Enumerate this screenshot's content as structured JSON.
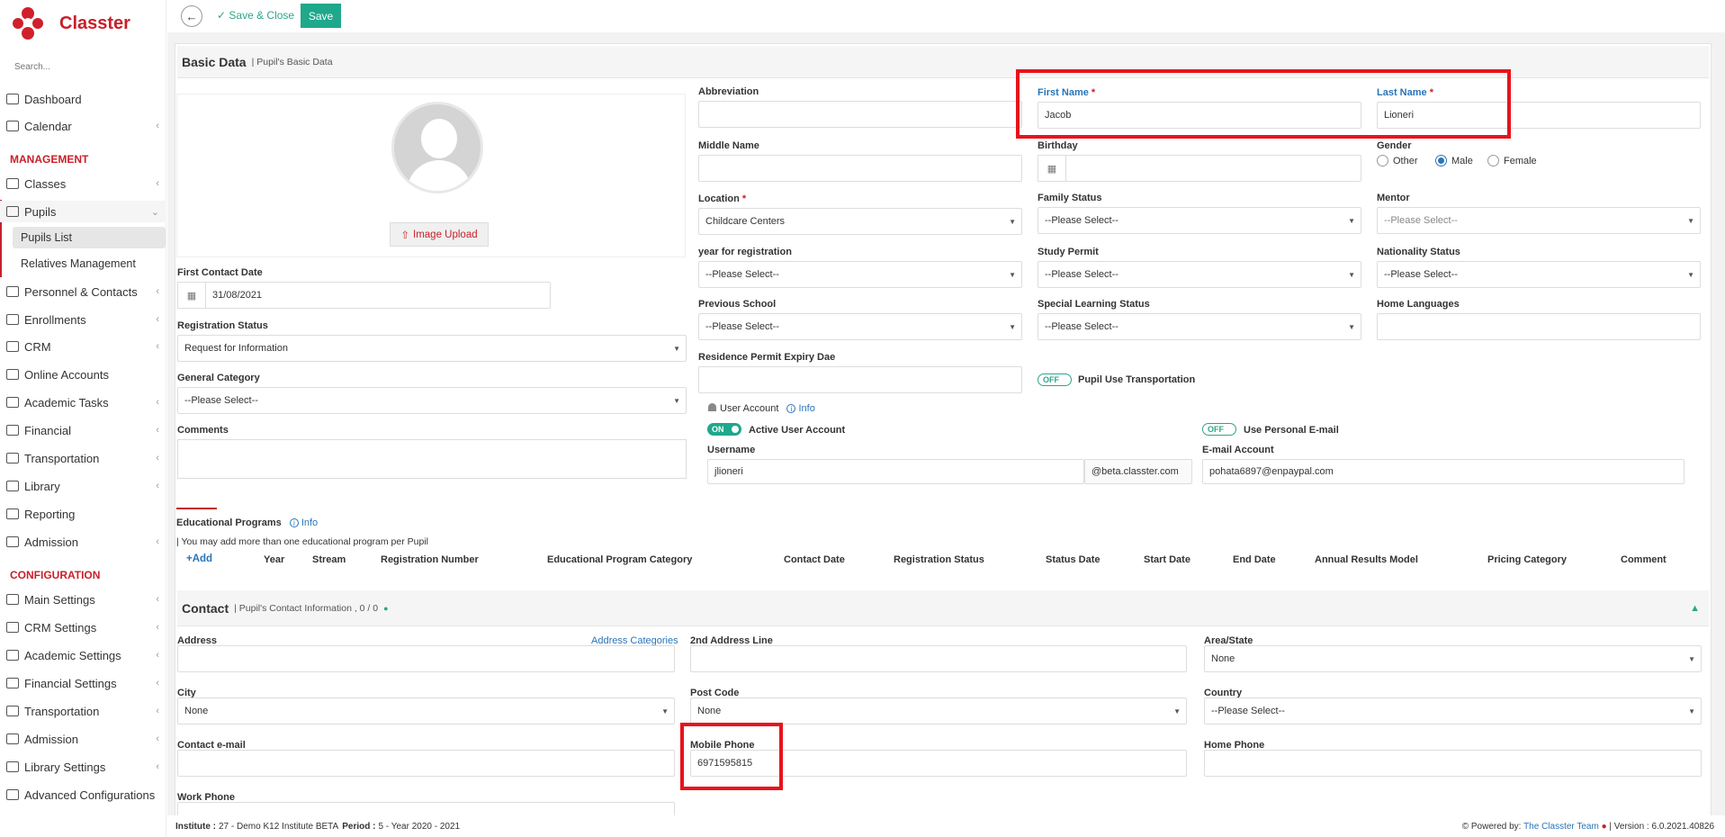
{
  "sidebar": {
    "brand": "Classter",
    "search_placeholder": "Search...",
    "items": {
      "dashboard": "Dashboard",
      "calendar": "Calendar",
      "classes": "Classes",
      "pupils": "Pupils",
      "personnel": "Personnel & Contacts",
      "enrollments": "Enrollments",
      "crm": "CRM",
      "online_accounts": "Online Accounts",
      "academic_tasks": "Academic Tasks",
      "financial": "Financial",
      "transportation": "Transportation",
      "library": "Library",
      "reporting": "Reporting",
      "admission": "Admission",
      "main_settings": "Main Settings",
      "crm_settings": "CRM Settings",
      "academic_settings": "Academic Settings",
      "financial_settings": "Financial Settings",
      "transportation2": "Transportation",
      "admission2": "Admission",
      "library_settings": "Library Settings",
      "advanced": "Advanced Configurations"
    },
    "sections": {
      "management": "MANAGEMENT",
      "configuration": "CONFIGURATION"
    },
    "sub": {
      "pupils_list": "Pupils List",
      "relatives": "Relatives Management"
    }
  },
  "toolbar": {
    "save_close": "Save & Close",
    "save": "Save"
  },
  "basic": {
    "title": "Basic Data",
    "subtitle": "| Pupil's Basic Data",
    "upload": "Image Upload",
    "labels": {
      "abbreviation": "Abbreviation",
      "first_name": "First Name",
      "last_name": "Last Name",
      "middle_name": "Middle Name",
      "birthday": "Birthday",
      "gender": "Gender",
      "location": "Location",
      "family_status": "Family Status",
      "mentor": "Mentor",
      "year_reg": "year for registration",
      "study_permit": "Study Permit",
      "nationality": "Nationality Status",
      "prev_school": "Previous School",
      "special": "Special Learning Status",
      "home_lang": "Home Languages",
      "residence": "Residence Permit Expiry Dae",
      "first_contact": "First Contact Date",
      "reg_status": "Registration Status",
      "gen_cat": "General Category",
      "comments": "Comments"
    },
    "values": {
      "first_name": "Jacob",
      "last_name": "Lioneri",
      "location": "Childcare Centers",
      "family_status": "--Please Select--",
      "mentor": "--Please Select--",
      "year_reg": "--Please Select--",
      "study_permit": "--Please Select--",
      "nationality": "--Please Select--",
      "prev_school": "--Please Select--",
      "special": "--Please Select--",
      "first_contact": "31/08/2021",
      "reg_status": "Request for Information",
      "gen_cat": "--Please Select--"
    },
    "gender_options": [
      "Other",
      "Male",
      "Female"
    ],
    "gender_selected": "Male",
    "transport_toggle": "OFF",
    "transport_label": "Pupil Use Transportation",
    "user_account": "User Account",
    "info": "Info",
    "active_toggle": "ON",
    "active_label": "Active User Account",
    "personal_toggle": "OFF",
    "personal_label": "Use Personal E-mail",
    "username_label": "Username",
    "username": "jlioneri",
    "domain": "@beta.classter.com",
    "email_label": "E-mail Account",
    "email": "pohata6897@enpaypal.com"
  },
  "edu": {
    "title": "Educational Programs",
    "info": "Info",
    "note": "| You may add more than one educational program per Pupil",
    "add": "Add",
    "columns": [
      "Year",
      "Stream",
      "Registration Number",
      "Educational Program Category",
      "Contact Date",
      "Registration Status",
      "Status Date",
      "Start Date",
      "End Date",
      "Annual Results Model",
      "Pricing Category",
      "Comment"
    ]
  },
  "contact": {
    "title": "Contact",
    "subtitle": "| Pupil's Contact Information , 0 / 0",
    "labels": {
      "address": "Address",
      "addr_cat": "Address Categories",
      "addr2": "2nd Address Line",
      "area": "Area/State",
      "city": "City",
      "post": "Post Code",
      "country": "Country",
      "email": "Contact e-mail",
      "mobile": "Mobile Phone",
      "home": "Home Phone",
      "work": "Work Phone"
    },
    "values": {
      "area": "None",
      "city": "None",
      "post": "None",
      "country": "--Please Select--",
      "mobile": "6971595815"
    }
  },
  "footer": {
    "inst_label": "Institute :",
    "inst_value": "27 - Demo K12 Institute BETA",
    "period_label": "Period :",
    "period_value": "5 - Year 2020 - 2021",
    "powered": "Powered by:",
    "team": "The Classter Team",
    "version": "| Version : 6.0.2021.40826"
  }
}
